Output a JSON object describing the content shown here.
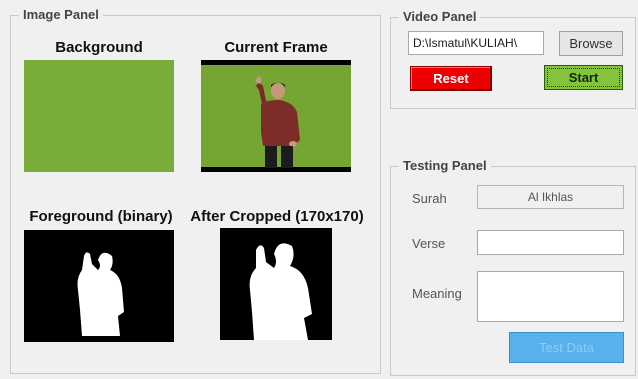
{
  "image_panel": {
    "legend": "Image Panel",
    "background_title": "Background",
    "current_frame_title": "Current Frame",
    "foreground_title": "Foreground (binary)",
    "cropped_title": "After Cropped (170x170)"
  },
  "video_panel": {
    "legend": "Video Panel",
    "path_value": "D:\\Ismatul\\KULIAH\\",
    "browse_label": "Browse",
    "reset_label": "Reset",
    "start_label": "Start"
  },
  "testing_panel": {
    "legend": "Testing Panel",
    "surah_label": "Surah",
    "surah_value": "Al Ikhlas",
    "verse_label": "Verse",
    "verse_value": "",
    "meaning_label": "Meaning",
    "meaning_value": "",
    "test_button_label": "Test Data"
  },
  "colors": {
    "chroma_green": "#7aac3a",
    "reset_red": "#ee0000",
    "start_green": "#84c43a",
    "test_blue": "#58b0ec"
  }
}
